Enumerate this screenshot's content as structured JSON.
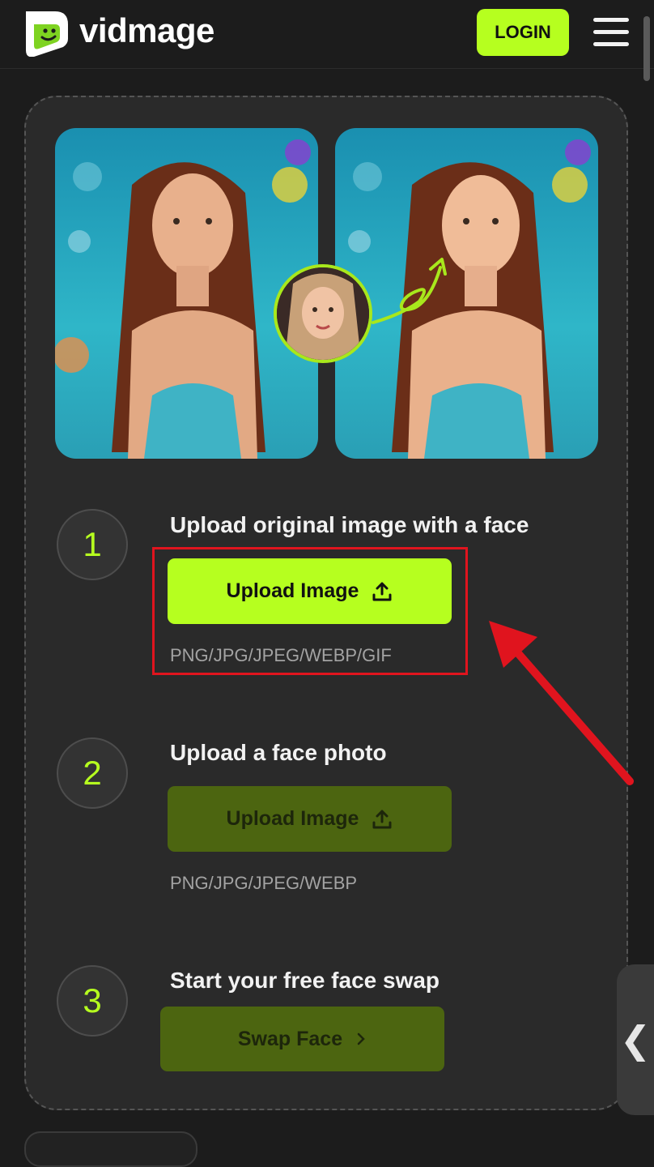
{
  "header": {
    "brand": "vidmage",
    "login_label": "LOGIN",
    "menu_icon": "hamburger-menu-icon"
  },
  "hero": {
    "images": [
      "original-image",
      "face-swapped-image"
    ],
    "face_thumbnail": "face-photo"
  },
  "steps": [
    {
      "number": "1",
      "title": "Upload original image with a face",
      "button_label": "Upload Image",
      "formats": "PNG/JPG/JPEG/WEBP/GIF",
      "button_state": "active"
    },
    {
      "number": "2",
      "title": "Upload a face photo",
      "button_label": "Upload Image",
      "formats": "PNG/JPG/JPEG/WEBP",
      "button_state": "disabled"
    },
    {
      "number": "3",
      "title": "Start your free face swap",
      "button_label": "Swap Face",
      "button_state": "disabled"
    }
  ],
  "side_tab": {
    "glyph": "❮"
  },
  "colors": {
    "accent": "#b6ff1f",
    "accent_dim": "#4c6510",
    "highlight": "#e0141e",
    "background": "#1c1c1c",
    "card": "#2a2a2a"
  }
}
